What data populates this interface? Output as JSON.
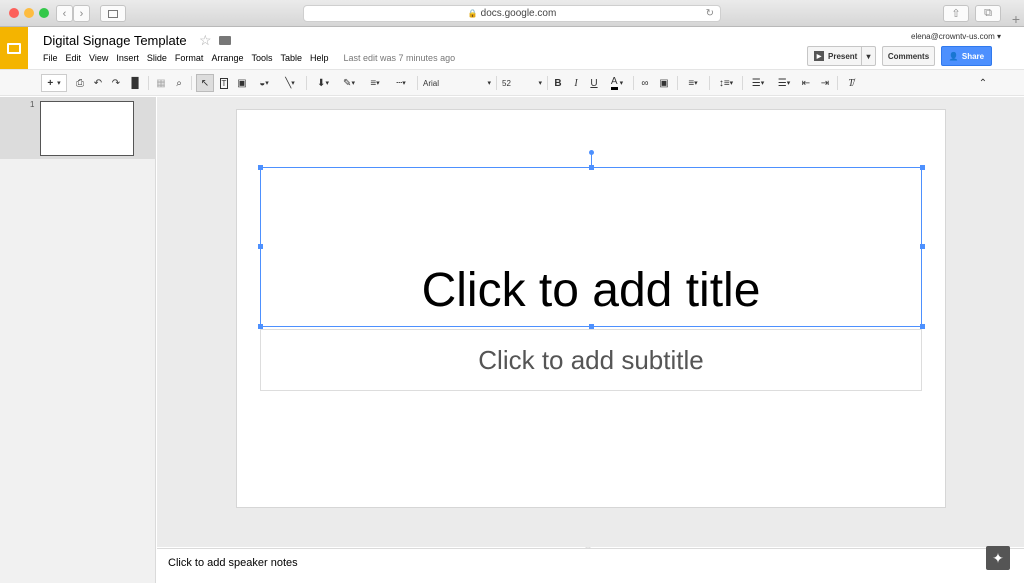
{
  "browser": {
    "url": "docs.google.com"
  },
  "app": {
    "title": "Digital Signage Template",
    "account": "elena@crowntv-us.com"
  },
  "menu": [
    "File",
    "Edit",
    "View",
    "Insert",
    "Slide",
    "Format",
    "Arrange",
    "Tools",
    "Table",
    "Help"
  ],
  "last_edit": "Last edit was 7 minutes ago",
  "buttons": {
    "present": "Present",
    "comments": "Comments",
    "share": "Share"
  },
  "toolbar": {
    "font": "Arial",
    "size": "52",
    "bold": "B",
    "italic": "I",
    "underline": "U",
    "textcolor": "A"
  },
  "filmstrip": {
    "slide_number": "1"
  },
  "slide": {
    "title": "Click to add title",
    "subtitle": "Click to add subtitle"
  },
  "notes": {
    "placeholder": "Click to add speaker notes"
  }
}
